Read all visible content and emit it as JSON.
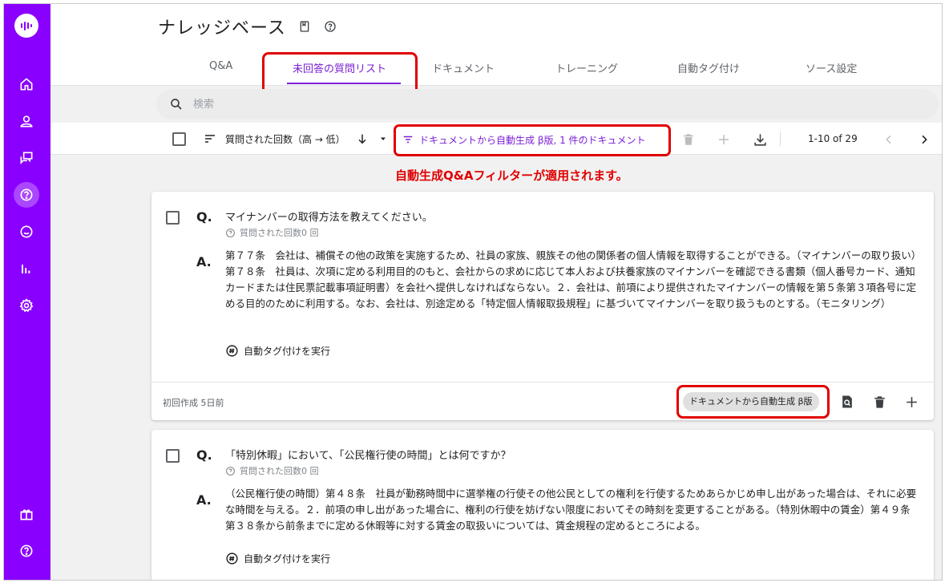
{
  "header": {
    "title": "ナレッジベース"
  },
  "tabs": [
    {
      "label": "Q&A",
      "active": false
    },
    {
      "label": "未回答の質問リスト",
      "active": true
    },
    {
      "label": "ドキュメント",
      "active": false
    },
    {
      "label": "トレーニング",
      "active": false
    },
    {
      "label": "自動タグ付け",
      "active": false
    },
    {
      "label": "ソース設定",
      "active": false
    }
  ],
  "search": {
    "placeholder": "検索"
  },
  "toolbar": {
    "sort_label": "質問された回数（高 → 低）",
    "filter_label": "ドキュメントから自動生成 β版, 1 件のドキュメント",
    "pager_text": "1-10 of 29"
  },
  "annotation": "自動生成Q&Aフィルターが適用されます。",
  "questions": [
    {
      "q_label": "Q.",
      "question": "マイナンバーの取得方法を教えてください。",
      "asked_count": "質問された回数0 回",
      "a_label": "A.",
      "answer": "第７７条　会社は、補償その他の政策を実施するため、社員の家族、親族その他の関係者の個人情報を取得することができる。（マイナンバーの取り扱い）第７８条　社員は、次項に定める利用目的のもと、会社からの求めに応じて本人および扶養家族のマイナンバーを確認できる書類（個人番号カード、通知カードまたは住民票記載事項証明書）を会社へ提供しなければならない。２．会社は、前項により提供されたマイナンバーの情報を第５条第３項各号に定める目的のために利用する。なお、会社は、別途定める「特定個人情報取扱規程」に基づいてマイナンバーを取り扱うものとする。（モニタリング）",
      "auto_tag": "自動タグ付けを実行",
      "created": "初回作成 5日前",
      "source_chip": "ドキュメントから自動生成 β版"
    },
    {
      "q_label": "Q.",
      "question": "「特別休暇」において、「公民権行使の時間」とは何ですか？",
      "asked_count": "質問された回数0 回",
      "a_label": "A.",
      "answer": "（公民権行使の時間）第４８条　社員が勤務時間中に選挙権の行使その他公民としての権利を行使するためあらかじめ申し出があった場合は、それに必要な時間を与える。２．前項の申し出があった場合に、権利の行使を妨げない限度においてその時刻を変更することがある。（特別休暇中の賃金）第４９条　第３８条から前条までに定める休暇等に対する賃金の取扱いについては、賃金規程の定めるところによる。",
      "auto_tag": "自動タグ付けを実行"
    }
  ],
  "colors": {
    "sidebar": "#8a00ff",
    "accent": "#7a1fd6",
    "highlight": "#e00000"
  }
}
